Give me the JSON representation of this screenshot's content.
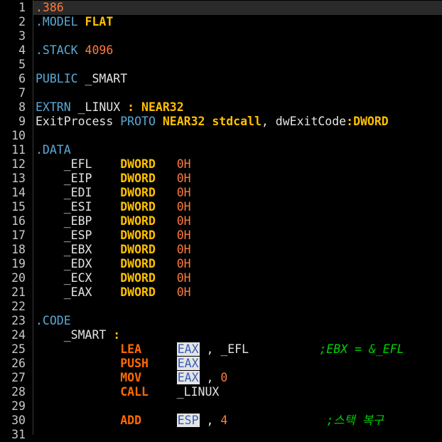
{
  "editor": {
    "lines": [
      {
        "n": "1",
        "tokens": [
          {
            "t": ".386",
            "c": "t-num"
          }
        ]
      },
      {
        "n": "2",
        "tokens": [
          {
            "t": ".MODEL ",
            "c": "t-dir"
          },
          {
            "t": "FLAT",
            "c": "t-kw"
          }
        ]
      },
      {
        "n": "3",
        "tokens": []
      },
      {
        "n": "4",
        "tokens": [
          {
            "t": ".STACK ",
            "c": "t-dir"
          },
          {
            "t": "4096",
            "c": "t-num"
          }
        ]
      },
      {
        "n": "5",
        "tokens": []
      },
      {
        "n": "6",
        "tokens": [
          {
            "t": "PUBLIC ",
            "c": "t-dir"
          },
          {
            "t": "_SMART",
            "c": "t-id"
          }
        ]
      },
      {
        "n": "7",
        "tokens": []
      },
      {
        "n": "8",
        "tokens": [
          {
            "t": "EXTRN ",
            "c": "t-dir"
          },
          {
            "t": "_LINUX ",
            "c": "t-id"
          },
          {
            "t": ": ",
            "c": "t-pun"
          },
          {
            "t": "NEAR32",
            "c": "t-kw"
          }
        ]
      },
      {
        "n": "9",
        "tokens": [
          {
            "t": "ExitProcess ",
            "c": "t-id"
          },
          {
            "t": "PROTO ",
            "c": "t-dir"
          },
          {
            "t": "NEAR32 stdcall",
            "c": "t-kw"
          },
          {
            "t": ", dwExitCode",
            "c": "t-id"
          },
          {
            "t": ":",
            "c": "t-pun"
          },
          {
            "t": "DWORD",
            "c": "t-kw"
          }
        ]
      },
      {
        "n": "10",
        "tokens": []
      },
      {
        "n": "11",
        "tokens": [
          {
            "t": ".DATA",
            "c": "t-dir"
          }
        ]
      },
      {
        "n": "12",
        "tokens": [
          {
            "t": "    _EFL    ",
            "c": "t-id"
          },
          {
            "t": "DWORD",
            "c": "t-kw"
          },
          {
            "t": "   0H",
            "c": "t-hex"
          }
        ]
      },
      {
        "n": "13",
        "tokens": [
          {
            "t": "    _EIP    ",
            "c": "t-id"
          },
          {
            "t": "DWORD",
            "c": "t-kw"
          },
          {
            "t": "   0H",
            "c": "t-hex"
          }
        ]
      },
      {
        "n": "14",
        "tokens": [
          {
            "t": "    _EDI    ",
            "c": "t-id"
          },
          {
            "t": "DWORD",
            "c": "t-kw"
          },
          {
            "t": "   0H",
            "c": "t-hex"
          }
        ]
      },
      {
        "n": "15",
        "tokens": [
          {
            "t": "    _ESI    ",
            "c": "t-id"
          },
          {
            "t": "DWORD",
            "c": "t-kw"
          },
          {
            "t": "   0H",
            "c": "t-hex"
          }
        ]
      },
      {
        "n": "16",
        "tokens": [
          {
            "t": "    _EBP    ",
            "c": "t-id"
          },
          {
            "t": "DWORD",
            "c": "t-kw"
          },
          {
            "t": "   0H",
            "c": "t-hex"
          }
        ]
      },
      {
        "n": "17",
        "tokens": [
          {
            "t": "    _ESP    ",
            "c": "t-id"
          },
          {
            "t": "DWORD",
            "c": "t-kw"
          },
          {
            "t": "   0H",
            "c": "t-hex"
          }
        ]
      },
      {
        "n": "18",
        "tokens": [
          {
            "t": "    _EBX    ",
            "c": "t-id"
          },
          {
            "t": "DWORD",
            "c": "t-kw"
          },
          {
            "t": "   0H",
            "c": "t-hex"
          }
        ]
      },
      {
        "n": "19",
        "tokens": [
          {
            "t": "    _EDX    ",
            "c": "t-id"
          },
          {
            "t": "DWORD",
            "c": "t-kw"
          },
          {
            "t": "   0H",
            "c": "t-hex"
          }
        ]
      },
      {
        "n": "20",
        "tokens": [
          {
            "t": "    _ECX    ",
            "c": "t-id"
          },
          {
            "t": "DWORD",
            "c": "t-kw"
          },
          {
            "t": "   0H",
            "c": "t-hex"
          }
        ]
      },
      {
        "n": "21",
        "tokens": [
          {
            "t": "    _EAX    ",
            "c": "t-id"
          },
          {
            "t": "DWORD",
            "c": "t-kw"
          },
          {
            "t": "   0H",
            "c": "t-hex"
          }
        ]
      },
      {
        "n": "22",
        "tokens": []
      },
      {
        "n": "23",
        "tokens": [
          {
            "t": ".CODE",
            "c": "t-dir"
          }
        ]
      },
      {
        "n": "24",
        "tokens": [
          {
            "t": "    _SMART ",
            "c": "t-id"
          },
          {
            "t": ":",
            "c": "t-pun"
          }
        ]
      },
      {
        "n": "25",
        "tokens": [
          {
            "t": "            ",
            "c": "t-id"
          },
          {
            "t": "LEA",
            "c": "t-op"
          },
          {
            "t": "     ",
            "c": "t-id"
          },
          {
            "t": "EAX",
            "c": "t-reg"
          },
          {
            "t": " , _EFL          ",
            "c": "t-id"
          },
          {
            "t": ";EBX = &_EFL",
            "c": "t-cm"
          }
        ]
      },
      {
        "n": "26",
        "tokens": [
          {
            "t": "            ",
            "c": "t-id"
          },
          {
            "t": "PUSH",
            "c": "t-op"
          },
          {
            "t": "    ",
            "c": "t-id"
          },
          {
            "t": "EAX",
            "c": "t-reg"
          }
        ]
      },
      {
        "n": "27",
        "tokens": [
          {
            "t": "            ",
            "c": "t-id"
          },
          {
            "t": "MOV",
            "c": "t-op"
          },
          {
            "t": "     ",
            "c": "t-id"
          },
          {
            "t": "EAX",
            "c": "t-reg"
          },
          {
            "t": " , ",
            "c": "t-id"
          },
          {
            "t": "0",
            "c": "t-num"
          }
        ]
      },
      {
        "n": "28",
        "tokens": [
          {
            "t": "            ",
            "c": "t-id"
          },
          {
            "t": "CALL",
            "c": "t-op"
          },
          {
            "t": "    _LINUX",
            "c": "t-id"
          }
        ]
      },
      {
        "n": "29",
        "tokens": []
      },
      {
        "n": "30",
        "tokens": [
          {
            "t": "            ",
            "c": "t-id"
          },
          {
            "t": "ADD",
            "c": "t-op"
          },
          {
            "t": "     ",
            "c": "t-id"
          },
          {
            "t": "ESP",
            "c": "t-reg"
          },
          {
            "t": " , ",
            "c": "t-id"
          },
          {
            "t": "4",
            "c": "t-num"
          },
          {
            "t": "              ",
            "c": "t-id"
          },
          {
            "t": ";스택 복구",
            "c": "t-cm"
          }
        ]
      },
      {
        "n": "31",
        "tokens": []
      }
    ]
  }
}
